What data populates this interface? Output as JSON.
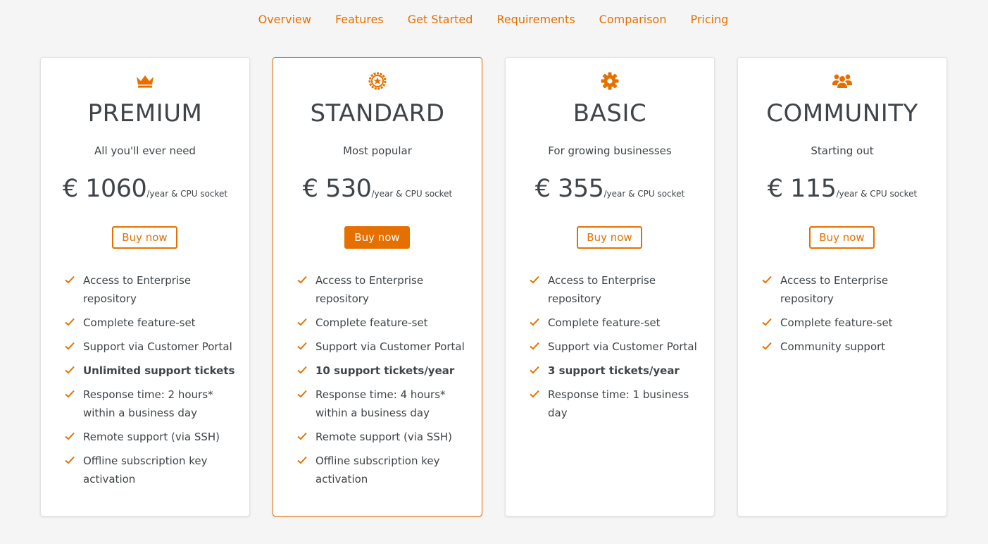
{
  "nav": {
    "items": [
      {
        "label": "Overview"
      },
      {
        "label": "Features"
      },
      {
        "label": "Get Started"
      },
      {
        "label": "Requirements"
      },
      {
        "label": "Comparison"
      },
      {
        "label": "Pricing"
      }
    ]
  },
  "colors": {
    "accent": "#e57000",
    "text": "#3f4448",
    "background": "#f5f5f5",
    "card": "#ffffff"
  },
  "plans": [
    {
      "name": "PREMIUM",
      "icon": "crown-icon",
      "tagline": "All you'll ever need",
      "price": "€ 1060",
      "unit": "/year & CPU socket",
      "button": "Buy now",
      "features": [
        {
          "text": "Access to Enterprise repository"
        },
        {
          "text": "Complete feature-set"
        },
        {
          "text": "Support via Customer Portal"
        },
        {
          "text": "Unlimited support tickets",
          "bold": true
        },
        {
          "text": "Response time: 2 hours* within a business day"
        },
        {
          "text": "Remote support (via SSH)"
        },
        {
          "text": "Offline subscription key activation"
        }
      ]
    },
    {
      "name": "STANDARD",
      "icon": "star-badge-icon",
      "tagline": "Most popular",
      "price": "€ 530",
      "unit": "/year & CPU socket",
      "button": "Buy now",
      "featured": true,
      "features": [
        {
          "text": "Access to Enterprise repository"
        },
        {
          "text": "Complete feature-set"
        },
        {
          "text": "Support via Customer Portal"
        },
        {
          "text": "10 support tickets/year",
          "bold": true
        },
        {
          "text": "Response time: 4 hours* within a business day"
        },
        {
          "text": "Remote support (via SSH)"
        },
        {
          "text": "Offline subscription key activation"
        }
      ]
    },
    {
      "name": "BASIC",
      "icon": "gear-icon",
      "tagline": "For growing businesses",
      "price": "€ 355",
      "unit": "/year & CPU socket",
      "button": "Buy now",
      "features": [
        {
          "text": "Access to Enterprise repository"
        },
        {
          "text": "Complete feature-set"
        },
        {
          "text": "Support via Customer Portal"
        },
        {
          "text": "3 support tickets/year",
          "bold": true
        },
        {
          "text": "Response time: 1 business day"
        }
      ]
    },
    {
      "name": "COMMUNITY",
      "icon": "users-icon",
      "tagline": "Starting out",
      "price": "€ 115",
      "unit": "/year & CPU socket",
      "button": "Buy now",
      "features": [
        {
          "text": "Access to Enterprise repository"
        },
        {
          "text": "Complete feature-set"
        },
        {
          "text": "Community support"
        }
      ]
    }
  ]
}
